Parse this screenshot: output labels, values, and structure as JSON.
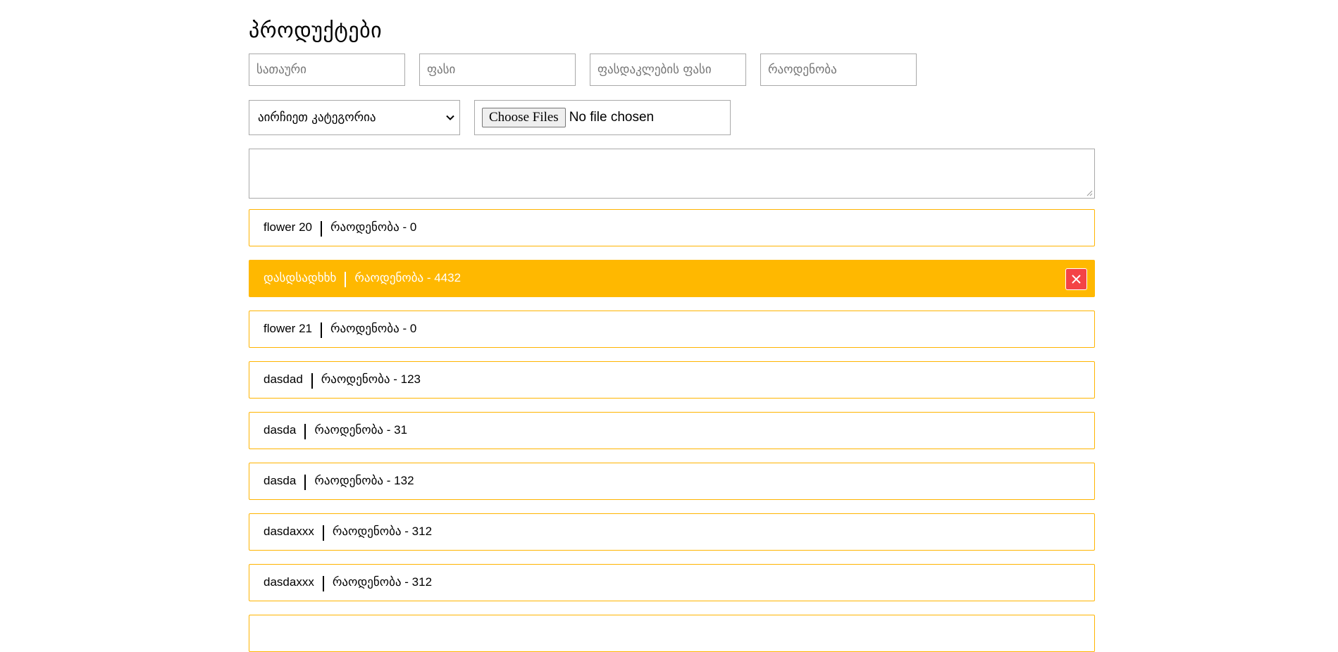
{
  "page": {
    "title": "პროდუქტები"
  },
  "form": {
    "title_placeholder": "სათაური",
    "price_placeholder": "ფასი",
    "discount_price_placeholder": "ფასდაკლების ფასი",
    "quantity_placeholder": "რაოდენობა",
    "category_selected": "აირჩიეთ კატეგორია",
    "file_button_label": "Choose Files",
    "file_status": "No file chosen",
    "description_value": ""
  },
  "products": [
    {
      "name": "flower 20",
      "quantity_text": "რაოდენობა - 0",
      "active": false
    },
    {
      "name": "დასდსადხხხ",
      "quantity_text": "რაოდენობა - 4432",
      "active": true
    },
    {
      "name": "flower 21",
      "quantity_text": "რაოდენობა - 0",
      "active": false
    },
    {
      "name": "dasdad",
      "quantity_text": "რაოდენობა - 123",
      "active": false
    },
    {
      "name": "dasda",
      "quantity_text": "რაოდენობა - 31",
      "active": false
    },
    {
      "name": "dasda",
      "quantity_text": "რაოდენობა - 132",
      "active": false
    },
    {
      "name": "dasdaxxx",
      "quantity_text": "რაოდენობა - 312",
      "active": false
    },
    {
      "name": "dasdaxxx",
      "quantity_text": "რაოდენობა - 312",
      "active": false
    },
    {
      "name": "",
      "quantity_text": "",
      "active": false
    }
  ],
  "colors": {
    "accent": "#ffb800",
    "border_accent": "#ffb400",
    "delete": "#f44346"
  },
  "icons": {
    "delete": "close-icon",
    "select": "chevron-down-icon"
  }
}
